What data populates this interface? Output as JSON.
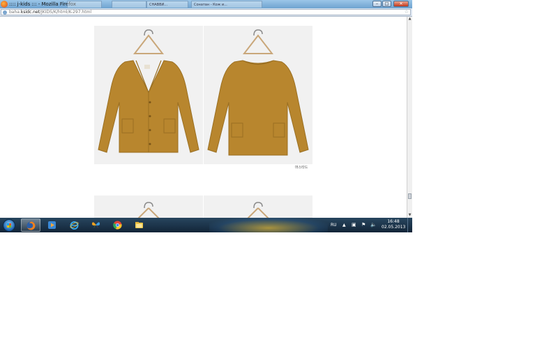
{
  "window": {
    "title": ":::: j-kids ::: - Mozilla Firefox",
    "background_tabs": [
      "",
      "",
      "СНАВВИ...",
      "Сонатан - Кож и..."
    ]
  },
  "address_bar": {
    "url_prefix": "baha.",
    "url_domain": "ksidc.net",
    "url_path": "/JKIDS/K/html/K-297.html"
  },
  "content": {
    "caption": "머스타드"
  },
  "taskbar": {
    "apps": [
      "firefox",
      "media-player",
      "internet-explorer",
      "butterfly-app",
      "chrome",
      "file-explorer"
    ],
    "language": "RU",
    "time": "16:48",
    "date": "02.05.2013"
  },
  "colors": {
    "garment": "#b8862e",
    "taskbar": "#1d354c",
    "titlebar": "#8ab8df"
  }
}
